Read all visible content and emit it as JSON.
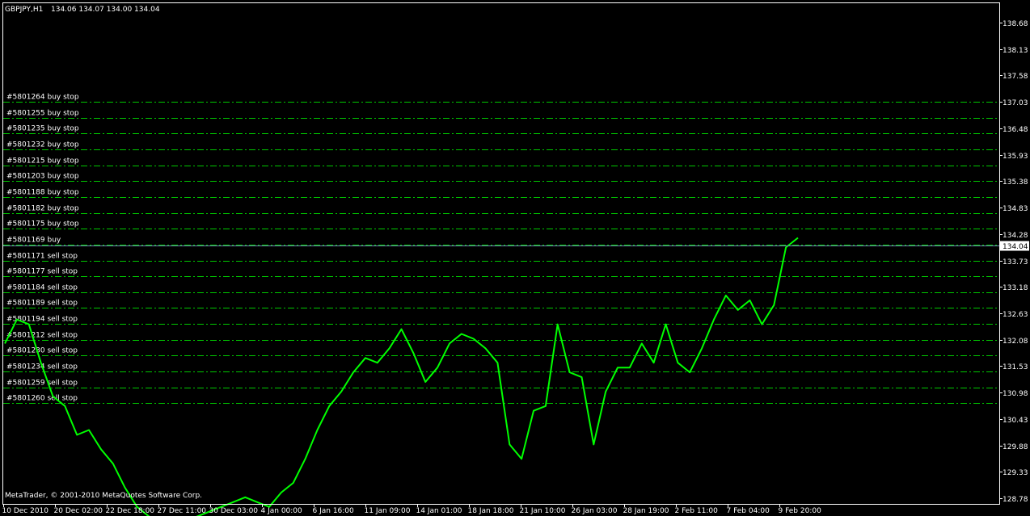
{
  "header": {
    "symbol": "GBPJPY,H1",
    "ohlc": "134.06 134.07 134.00 134.04"
  },
  "footer": {
    "copyright": "MetaTrader, © 2001-2010 MetaQuotes Software Corp."
  },
  "colors": {
    "background": "#000000",
    "price_line": "#00ff00",
    "order_line": "#00c800",
    "bid_line": "#6e8cb4",
    "text": "#ffffff"
  },
  "orders": [
    {
      "label": "#5801264 buy stop",
      "price": 137.03
    },
    {
      "label": "#5801255 buy stop",
      "price": 136.7
    },
    {
      "label": "#5801235 buy stop",
      "price": 136.37
    },
    {
      "label": "#5801232 buy stop",
      "price": 136.04
    },
    {
      "label": "#5801215 buy stop",
      "price": 135.71
    },
    {
      "label": "#5801203 buy stop",
      "price": 135.38
    },
    {
      "label": "#5801188 buy stop",
      "price": 135.05
    },
    {
      "label": "#5801182 buy stop",
      "price": 134.72
    },
    {
      "label": "#5801175 buy stop",
      "price": 134.39
    },
    {
      "label": "#5801169 buy",
      "price": 134.06
    },
    {
      "label": "#5801171 sell stop",
      "price": 133.73
    },
    {
      "label": "#5801177 sell stop",
      "price": 133.4
    },
    {
      "label": "#5801184 sell stop",
      "price": 133.07
    },
    {
      "label": "#5801189 sell stop",
      "price": 132.74
    },
    {
      "label": "#5801194 sell stop",
      "price": 132.41
    },
    {
      "label": "#5801212 sell stop",
      "price": 132.08
    },
    {
      "label": "#5801230 sell stop",
      "price": 131.75
    },
    {
      "label": "#5801234 sell stop",
      "price": 131.42
    },
    {
      "label": "#5801259 sell stop",
      "price": 131.09
    },
    {
      "label": "#5801260 sell stop",
      "price": 130.76
    }
  ],
  "chart_data": {
    "type": "line",
    "title": "GBPJPY,H1",
    "current_price": 134.04,
    "ylim": [
      128.55,
      139.0
    ],
    "y_ticks": [
      "138.68",
      "138.13",
      "137.58",
      "137.03",
      "136.48",
      "135.93",
      "135.38",
      "134.83",
      "134.28",
      "133.73",
      "133.18",
      "132.63",
      "132.08",
      "131.53",
      "130.98",
      "130.43",
      "129.88",
      "129.33",
      "128.78"
    ],
    "x_ticks": [
      "10 Dec 2010",
      "20 Dec 02:00",
      "22 Dec 18:00",
      "27 Dec 11:00",
      "30 Dec 03:00",
      "4 Jan 00:00",
      "6 Jan 16:00",
      "11 Jan 09:00",
      "14 Jan 01:00",
      "18 Jan 18:00",
      "21 Jan 10:00",
      "26 Jan 03:00",
      "28 Jan 19:00",
      "2 Feb 11:00",
      "7 Feb 04:00",
      "9 Feb 20:00"
    ],
    "series": [
      {
        "values": [
          132.0,
          132.5,
          132.4,
          131.6,
          130.9,
          130.7,
          130.1,
          130.2,
          129.8,
          129.5,
          129.0,
          128.6,
          128.4,
          128.3,
          128.2,
          128.3,
          128.4,
          128.5,
          128.6,
          128.7,
          128.8,
          128.7,
          128.6,
          128.9,
          129.1,
          129.6,
          130.2,
          130.7,
          131.0,
          131.4,
          131.7,
          131.6,
          131.9,
          132.3,
          131.8,
          131.2,
          131.5,
          132.0,
          132.2,
          132.1,
          131.9,
          131.6,
          129.9,
          129.6,
          130.6,
          130.7,
          132.4,
          131.4,
          131.3,
          129.9,
          131.0,
          131.5,
          131.5,
          132.0,
          131.6,
          132.4,
          131.6,
          131.4,
          131.9,
          132.5,
          133.0,
          132.7,
          132.9,
          132.4,
          132.8,
          134.0,
          134.2
        ]
      }
    ]
  }
}
